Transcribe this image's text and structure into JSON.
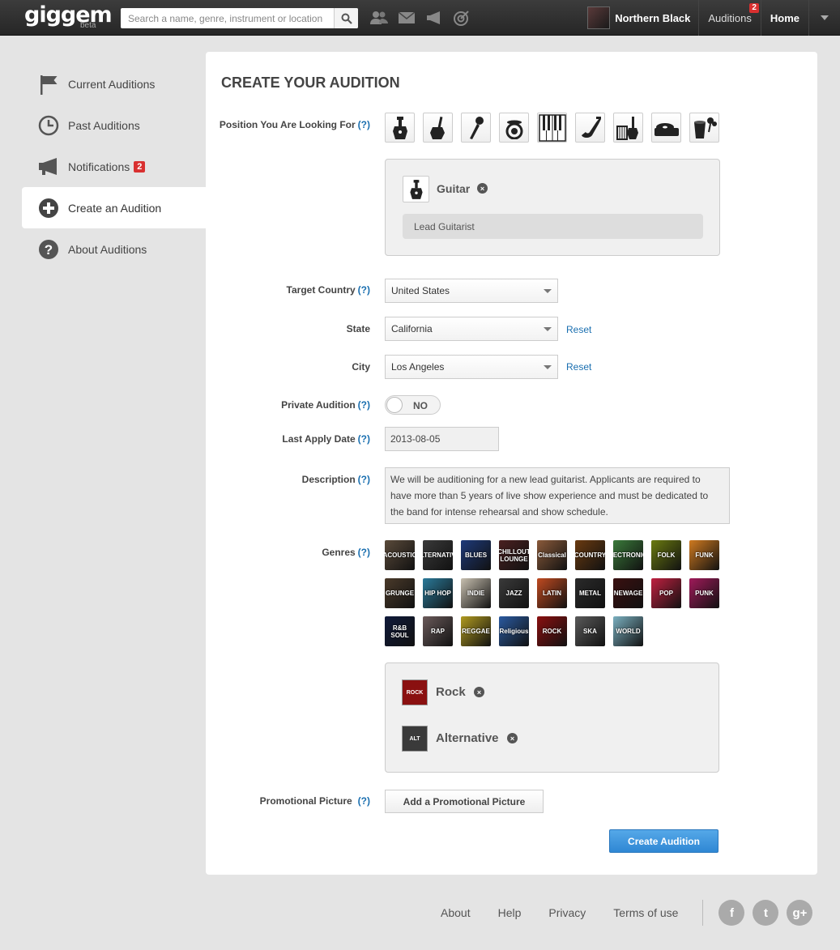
{
  "app": {
    "logo_text": "giggem",
    "logo_beta": "beta"
  },
  "search": {
    "placeholder": "Search a name, genre, instrument or location"
  },
  "topnav": {
    "icons": [
      "friends-icon",
      "mail-icon",
      "megaphone-icon",
      "target-icon"
    ],
    "user_name": "Northern Black",
    "auditions_label": "Auditions",
    "auditions_badge": "2",
    "home_label": "Home"
  },
  "sidebar": {
    "items": [
      {
        "label": "Current Auditions",
        "icon": "flag-icon"
      },
      {
        "label": "Past Auditions",
        "icon": "clock-icon"
      },
      {
        "label": "Notifications",
        "icon": "megaphone-icon",
        "badge": "2"
      },
      {
        "label": "Create an Audition",
        "icon": "plus-circle-icon",
        "active": true
      },
      {
        "label": "About Auditions",
        "icon": "question-circle-icon"
      }
    ]
  },
  "form": {
    "title": "CREATE YOUR AUDITION",
    "help_marker": "(?)",
    "position_label": "Position You Are Looking For",
    "positions": [
      "guitar",
      "bass",
      "microphone",
      "drums",
      "keyboard",
      "saxophone",
      "strings",
      "turntable",
      "percussion"
    ],
    "selected_position": {
      "name": "Guitar",
      "role_value": "Lead Guitarist"
    },
    "target_country_label": "Target Country",
    "target_country_value": "United States",
    "state_label": "State",
    "state_value": "California",
    "city_label": "City",
    "city_value": "Los Angeles",
    "reset_label": "Reset",
    "private_label": "Private Audition",
    "private_value": "NO",
    "last_apply_label": "Last Apply Date",
    "last_apply_value": "2013-08-05",
    "description_label": "Description",
    "description_value": "We will be auditioning for a new lead guitarist. Applicants are required to have more than 5 years of live show experience and must be dedicated to the band for intense rehearsal and show schedule.",
    "genres_label": "Genres",
    "genres": [
      {
        "name": "ACOUSTIC",
        "color": "#5a4a3a"
      },
      {
        "name": "ALTERNATIVE",
        "color": "#3a3a3a"
      },
      {
        "name": "BLUES",
        "color": "#1e3a7a"
      },
      {
        "name": "CHILLOUT LOUNGE",
        "color": "#4a2020"
      },
      {
        "name": "Classical",
        "color": "#8a5a3a"
      },
      {
        "name": "COUNTRY",
        "color": "#6a3a10"
      },
      {
        "name": "ELECTRONICA",
        "color": "#3a7a3a"
      },
      {
        "name": "FOLK",
        "color": "#6a7a10"
      },
      {
        "name": "FUNK",
        "color": "#d07a20"
      },
      {
        "name": "GRUNGE",
        "color": "#4a3a2a"
      },
      {
        "name": "HIP HOP",
        "color": "#2a7a9a"
      },
      {
        "name": "INDIE",
        "color": "#c8c0b0"
      },
      {
        "name": "JAZZ",
        "color": "#3a3a3a"
      },
      {
        "name": "LATIN",
        "color": "#c04a20"
      },
      {
        "name": "METAL",
        "color": "#2a2a2a"
      },
      {
        "name": "NEWAGE",
        "color": "#3a1010"
      },
      {
        "name": "POP",
        "color": "#c02040"
      },
      {
        "name": "PUNK",
        "color": "#a01a5a"
      },
      {
        "name": "R&B SOUL",
        "color": "#101a3a"
      },
      {
        "name": "RAP",
        "color": "#6a5a5a"
      },
      {
        "name": "REGGAE",
        "color": "#b09a20"
      },
      {
        "name": "Religious",
        "color": "#2a5aa0"
      },
      {
        "name": "ROCK",
        "color": "#8a1010"
      },
      {
        "name": "SKA",
        "color": "#5a5a5a"
      },
      {
        "name": "WORLD",
        "color": "#7ab0c0"
      }
    ],
    "selected_genres": [
      {
        "name": "Rock",
        "tile": "ROCK",
        "color": "#8a1010"
      },
      {
        "name": "Alternative",
        "tile": "ALT",
        "color": "#3a3a3a"
      }
    ],
    "promo_label": "Promotional Picture",
    "promo_button": "Add a Promotional Picture",
    "submit_button": "Create Audition"
  },
  "footer": {
    "links": [
      "About",
      "Help",
      "Privacy",
      "Terms of use"
    ],
    "social": [
      "f",
      "t",
      "g+"
    ]
  }
}
